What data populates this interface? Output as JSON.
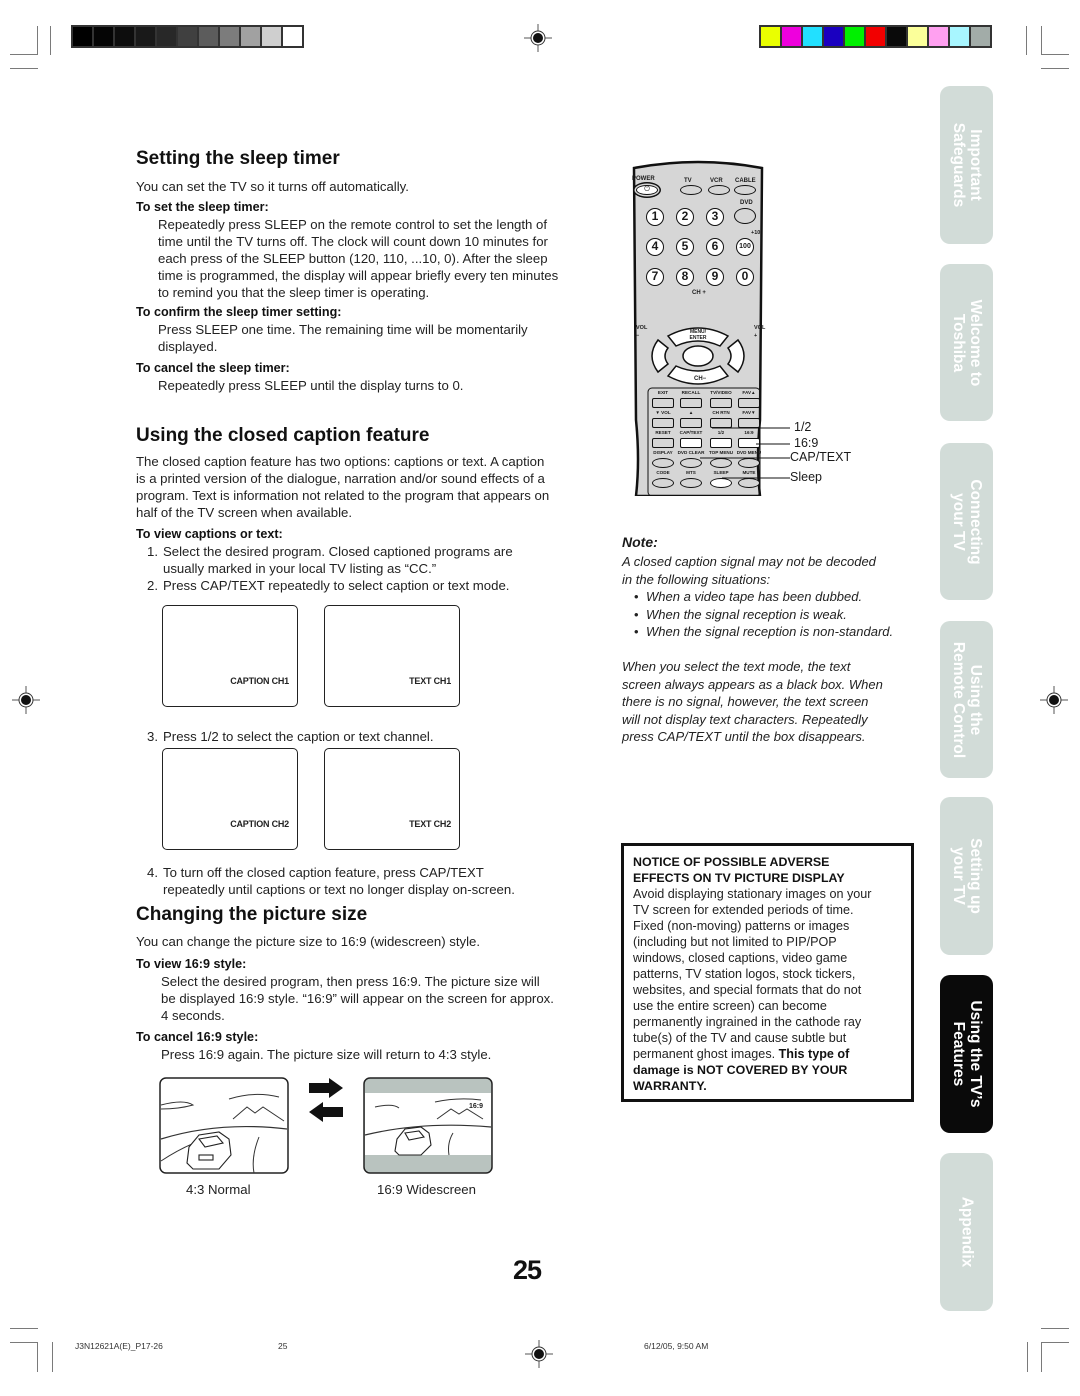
{
  "print_marks": {
    "grayscale_swatches": [
      "#000000",
      "#050505",
      "#0d0d0d",
      "#191919",
      "#282828",
      "#404040",
      "#5c5c5c",
      "#7c7c7c",
      "#a1a1a1",
      "#cfcfcf",
      "#ffffff"
    ],
    "color_swatches": [
      "#eaff00",
      "#ee00dd",
      "#22e0ff",
      "#1a00c0",
      "#00f000",
      "#f20000",
      "#0a0a0a",
      "#fbff9a",
      "#ffa0f0",
      "#a8f6ff",
      "#a2aca8"
    ]
  },
  "sleep_timer": {
    "heading": "Setting the sleep timer",
    "intro": "You can set the TV so it turns off automatically.",
    "set_label": "To set the sleep timer:",
    "set_lines": [
      "Repeatedly press SLEEP on the remote control to set the length of",
      "time until the TV turns off. The clock will count down 10 minutes for",
      "each press of the SLEEP button (120, 110, ...10, 0). After the sleep",
      "time is programmed, the display will appear briefly every ten minutes",
      "to remind you that the sleep timer is operating."
    ],
    "confirm_label": "To confirm the sleep timer setting:",
    "confirm_lines": [
      "Press SLEEP one time. The remaining time will be momentarily",
      "displayed."
    ],
    "cancel_label": "To cancel the sleep timer:",
    "cancel_text": "Repeatedly press SLEEP until the display turns to 0."
  },
  "closed_caption": {
    "heading": "Using the closed caption feature",
    "intro_lines": [
      "The closed caption feature has two options: captions or text. A caption",
      "is a printed version of the dialogue, narration and/or sound effects of a",
      "program. Text is information not related to the program that appears on",
      "half of the TV screen when available."
    ],
    "view_label": "To view captions or text:",
    "steps": [
      {
        "num": "1.",
        "lines": [
          "Select the desired program. Closed captioned programs are",
          "usually marked in your local TV listing as “CC.”"
        ]
      },
      {
        "num": "2.",
        "lines": [
          "Press CAP/TEXT repeatedly to select caption or text mode."
        ]
      },
      {
        "num": "3.",
        "lines": [
          "Press 1/2 to select the caption or text channel."
        ]
      },
      {
        "num": "4.",
        "lines": [
          "To turn off the closed caption feature, press CAP/TEXT",
          "repeatedly until captions or text no longer display on-screen."
        ]
      }
    ],
    "screens_row1": [
      "CAPTION CH1",
      "TEXT CH1"
    ],
    "screens_row2": [
      "CAPTION CH2",
      "TEXT CH2"
    ]
  },
  "picture_size": {
    "heading": "Changing the picture size",
    "intro": "You can change the picture size to 16:9 (widescreen) style.",
    "view_label": "To view 16:9 style:",
    "view_lines": [
      "Select the desired program, then press 16:9. The picture size will",
      "be displayed 16:9 style. “16:9” will appear on the screen for approx.",
      "4 seconds."
    ],
    "cancel_label": "To cancel 16:9 style:",
    "cancel_text": "Press 16:9 again. The picture size will return to 4:3 style.",
    "normal_caption": "4:3 Normal",
    "wide_caption": "16:9 Widescreen",
    "wide_osd": "16:9"
  },
  "remote": {
    "top_labels": [
      "POWER",
      "TV",
      "VCR",
      "CABLE"
    ],
    "dvd_label": "DVD",
    "plus10_label": "+10",
    "digits": [
      "1",
      "2",
      "3",
      "",
      "4",
      "5",
      "6",
      "100",
      "7",
      "8",
      "9",
      "0"
    ],
    "ch_plus": "CH +",
    "ch_minus": "CH−",
    "vol_minus": "VOL\n−",
    "vol_plus": "VOL\n+",
    "menu_enter": [
      "MENU/",
      "ENTER"
    ],
    "row_labels": [
      [
        "EXIT",
        "RECALL",
        "TV/VIDEO",
        "FAV▲"
      ],
      [
        "▼  VOL",
        "▲",
        "CH RTN",
        "FAV▼"
      ],
      [
        "RESET",
        "CAP/TEXT",
        "1/2",
        "16:9"
      ],
      [
        "DISPLAY",
        "DVD CLEAR",
        "TOP MENU",
        "DVD MENU"
      ],
      [
        "CODE",
        "MTS",
        "SLEEP",
        "MUTE"
      ]
    ],
    "callouts": [
      "1/2",
      "16:9",
      "CAP/TEXT",
      "Sleep"
    ]
  },
  "note": {
    "title": "Note:",
    "intro_lines": [
      "A closed caption signal may not be decoded",
      "in the following situations:"
    ],
    "bullets": [
      "When a video tape has been dubbed.",
      "When the signal reception is weak.",
      "When the signal reception is non-standard."
    ],
    "para_lines": [
      "When you select the text mode, the text",
      "screen always appears as a black box. When",
      "there is no signal, however, the text screen",
      "will not display text characters. Repeatedly",
      "press CAP/TEXT until the box disappears."
    ]
  },
  "notice": {
    "heading_lines": [
      "NOTICE OF POSSIBLE ADVERSE",
      "EFFECTS ON TV PICTURE DISPLAY"
    ],
    "body_lines": [
      "Avoid displaying stationary images on your",
      "TV screen for extended periods of time.",
      "Fixed (non-moving) patterns or images",
      "(including but not limited to PIP/POP",
      "windows, closed captions, video game",
      "patterns, TV station logos, stock tickers,",
      "websites, and special formats that do not",
      "use the entire screen) can become",
      "permanently ingrained in the cathode ray",
      "tube(s) of the TV and cause subtle but"
    ],
    "last_line_plain": "permanent ghost images. ",
    "last_line_bold": "This type of",
    "bold_lines": [
      "damage is NOT COVERED BY YOUR",
      "WARRANTY."
    ]
  },
  "side_tabs": [
    {
      "lines": [
        "Important",
        "Safeguards"
      ],
      "active": false
    },
    {
      "lines": [
        "Welcome to",
        "Toshiba"
      ],
      "active": false
    },
    {
      "lines": [
        "Connecting",
        "your TV"
      ],
      "active": false
    },
    {
      "lines": [
        "Using the",
        "Remote Control"
      ],
      "active": false
    },
    {
      "lines": [
        "Setting up",
        "your TV"
      ],
      "active": false
    },
    {
      "lines": [
        "Using the TV’s",
        "Features"
      ],
      "active": true
    },
    {
      "lines": [
        "Appendix"
      ],
      "active": false
    }
  ],
  "page_number": "25",
  "footer": {
    "file": "J3N12621A(E)_P17-26",
    "page": "25",
    "date": "6/12/05, 9:50 AM"
  }
}
